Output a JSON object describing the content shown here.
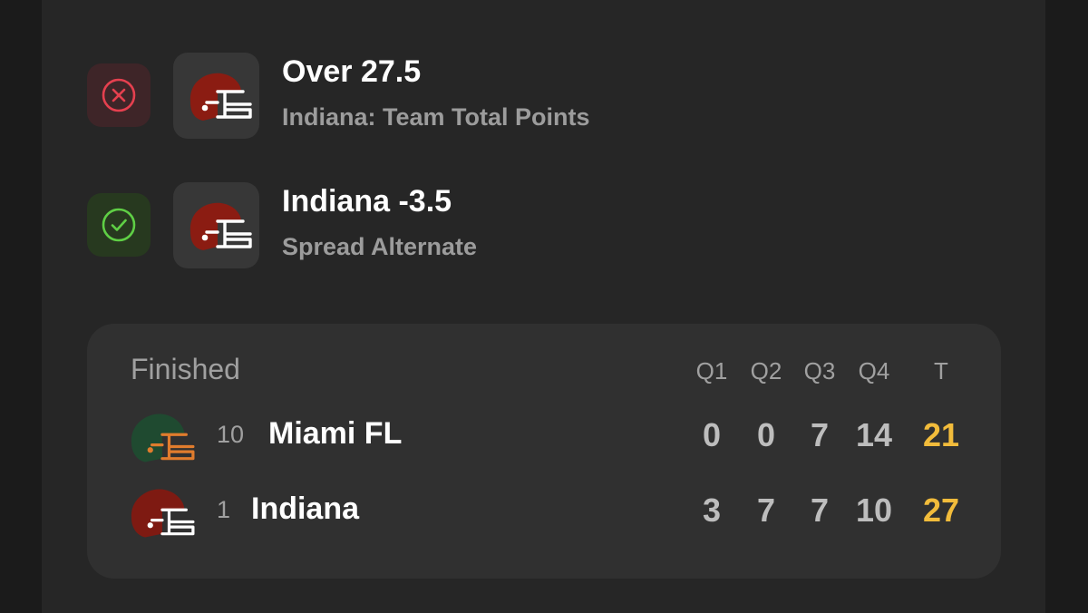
{
  "legs": [
    {
      "result": "lost",
      "status_icon": "x-circle-icon",
      "team_icon": "helmet-icon",
      "title": "Over 27.5",
      "subtitle": "Indiana: Team Total Points"
    },
    {
      "result": "won",
      "status_icon": "check-circle-icon",
      "team_icon": "helmet-icon",
      "title": "Indiana -3.5",
      "subtitle": "Spread Alternate"
    }
  ],
  "scoreboard": {
    "status": "Finished",
    "headers": [
      "Q1",
      "Q2",
      "Q3",
      "Q4",
      "T"
    ],
    "teams": [
      {
        "seed": "10",
        "name": "Miami FL",
        "scores": [
          "0",
          "0",
          "7",
          "14"
        ],
        "total": "21",
        "helmet_shell": "#1f4a30",
        "helmet_mask": "#e07c2d"
      },
      {
        "seed": "1",
        "name": "Indiana",
        "scores": [
          "3",
          "7",
          "7",
          "10"
        ],
        "total": "27",
        "helmet_shell": "#7e1a12",
        "helmet_mask": "#ffffff"
      }
    ]
  },
  "colors": {
    "lost_red": "#e5404f",
    "won_green": "#5fcf45",
    "total_gold": "#f2bc3b",
    "indiana_crimson": "#8b1c12"
  }
}
